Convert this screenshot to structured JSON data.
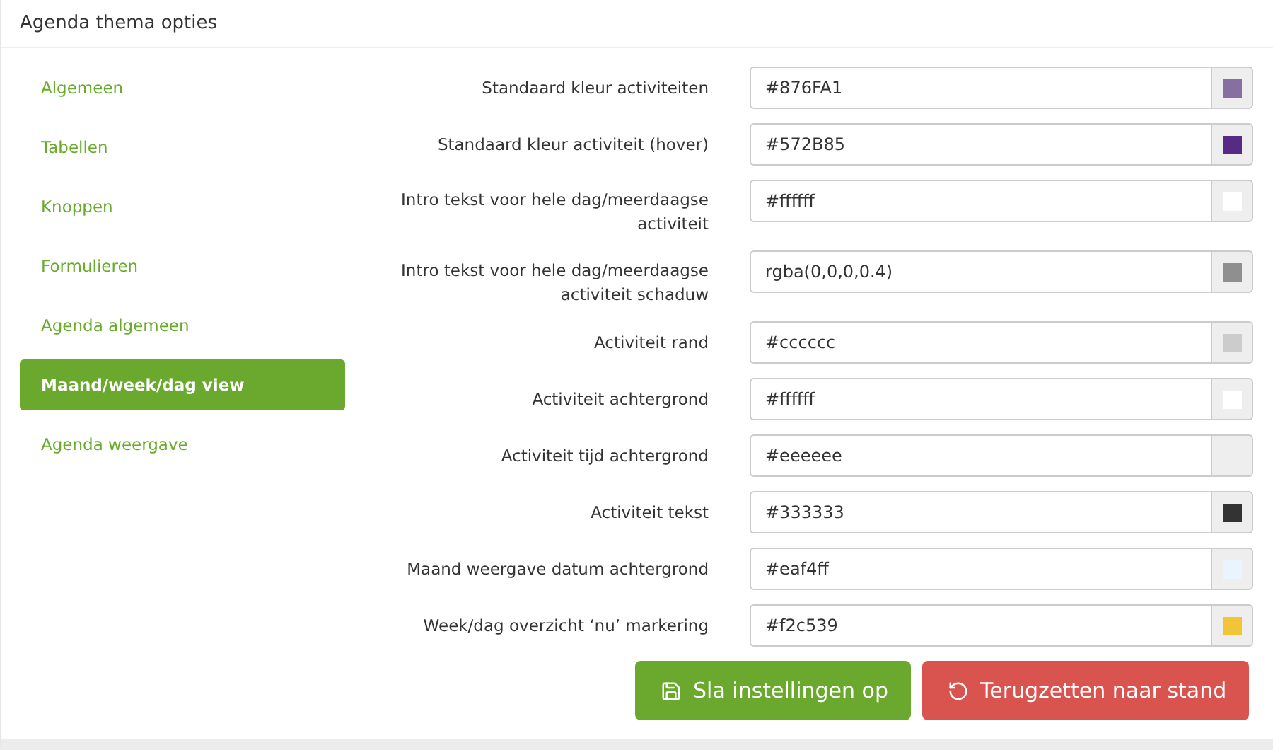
{
  "panel": {
    "title": "Agenda thema opties"
  },
  "sidebar": {
    "items": [
      {
        "label": "Algemeen",
        "selected": false
      },
      {
        "label": "Tabellen",
        "selected": false
      },
      {
        "label": "Knoppen",
        "selected": false
      },
      {
        "label": "Formulieren",
        "selected": false
      },
      {
        "label": "Agenda algemeen",
        "selected": false
      },
      {
        "label": "Maand/week/dag view",
        "selected": true
      },
      {
        "label": "Agenda weergave",
        "selected": false
      }
    ]
  },
  "fields": [
    {
      "label": "Standaard kleur activiteiten",
      "value": "#876FA1"
    },
    {
      "label": "Standaard kleur activiteit (hover)",
      "value": "#572B85"
    },
    {
      "label": "Intro tekst voor hele dag/meerdaagse activiteit",
      "value": "#ffffff"
    },
    {
      "label": "Intro tekst voor hele dag/meerdaagse activiteit schaduw",
      "value": "rgba(0,0,0,0.4)"
    },
    {
      "label": "Activiteit rand",
      "value": "#cccccc"
    },
    {
      "label": "Activiteit achtergrond",
      "value": "#ffffff"
    },
    {
      "label": "Activiteit tijd achtergrond",
      "value": "#eeeeee"
    },
    {
      "label": "Activiteit tekst",
      "value": "#333333"
    },
    {
      "label": "Maand weergave datum achtergrond",
      "value": "#eaf4ff"
    },
    {
      "label": "Week/dag overzicht ‘nu’ markering",
      "value": "#f2c539"
    }
  ],
  "buttons": [
    {
      "label": "Sla instellingen op",
      "kind": "save"
    },
    {
      "label": "Terugzetten naar stand",
      "kind": "reset"
    }
  ]
}
